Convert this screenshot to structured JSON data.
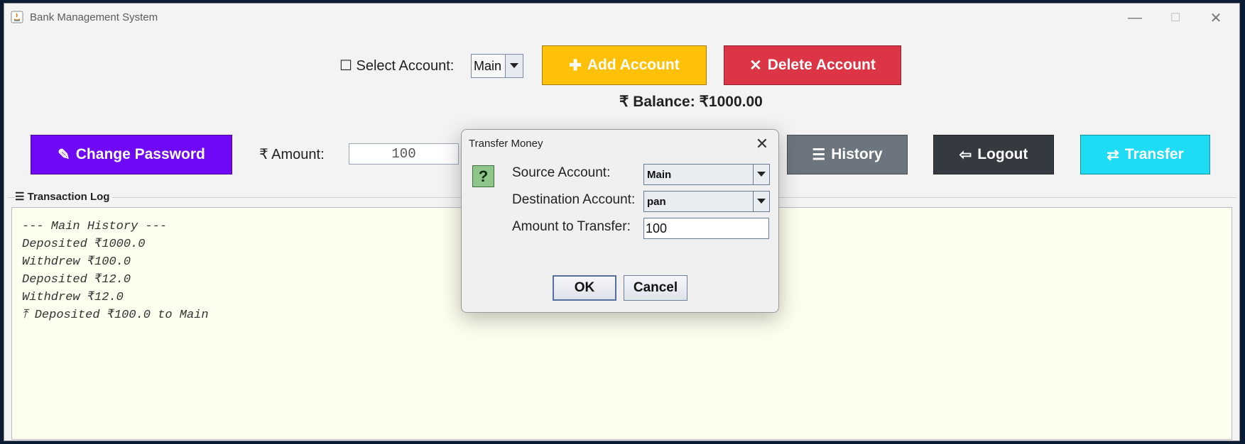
{
  "window": {
    "title": "Bank Management System",
    "controls": {
      "minimize": "—",
      "maximize": "☐",
      "close": "✕"
    }
  },
  "toolbar": {
    "select_account_label": "☐ Select Account:",
    "account_selected": "Main",
    "add_account_icon": "✚",
    "add_account_label": "Add Account",
    "delete_account_icon": "✕",
    "delete_account_label": "Delete Account",
    "balance_text": "₹ Balance: ₹1000.00",
    "change_password_icon": "✎",
    "change_password_label": "Change Password",
    "amount_label": "₹ Amount:",
    "amount_value": "100",
    "history_icon": "☰",
    "history_label": "History",
    "logout_icon": "⇦",
    "logout_label": "Logout",
    "transfer_icon": "⇄",
    "transfer_label": "Transfer"
  },
  "log": {
    "title": "☰ Transaction Log",
    "lines": [
      "--- Main History ---",
      "Deposited ₹1000.0",
      "Withdrew ₹100.0",
      "Deposited ₹12.0",
      "Withdrew ₹12.0",
      "⤒ Deposited ₹100.0 to Main"
    ]
  },
  "dialog": {
    "title": "Transfer Money",
    "close": "✕",
    "icon": "?",
    "source_label": "Source Account:",
    "source_value": "Main",
    "destination_label": "Destination Account:",
    "destination_value": "pan",
    "amount_label": "Amount to Transfer:",
    "amount_value": "100",
    "ok_label": "OK",
    "cancel_label": "Cancel"
  },
  "colors": {
    "add_account": "#ffc107",
    "delete_account": "#dc3545",
    "change_password": "#6f08f5",
    "history": "#6c757d",
    "logout": "#343a40",
    "transfer": "#1fdcf5",
    "log_background": "#fefeee"
  },
  "icons": [
    "java-app-icon",
    "chevron-down-icon",
    "question-icon"
  ]
}
